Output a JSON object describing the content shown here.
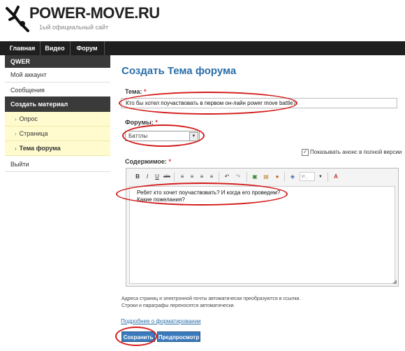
{
  "header": {
    "site_title": "POWER-MOVE.RU",
    "slogan": "1ый официальный сайт"
  },
  "nav": [
    {
      "label": "Главная"
    },
    {
      "label": "Видео"
    },
    {
      "label": "Форум"
    }
  ],
  "sidebar": {
    "username": "QWER",
    "items": [
      {
        "label": "Мой аккаунт"
      },
      {
        "label": "Сообщения"
      },
      {
        "label": "Создать материал"
      },
      {
        "label": "Опрос"
      },
      {
        "label": "Страница"
      },
      {
        "label": "Тема форума"
      },
      {
        "label": "Выйти"
      }
    ]
  },
  "main": {
    "page_title": "Создать Тема форума",
    "title_label": "Тема:",
    "title_value": "Кто бы хотел поучаствовать в первом он-лайн power move battle?",
    "forums_label": "Форумы:",
    "forum_selected": "Баттлы",
    "announce_label": "Показывать анонс в полной версии",
    "announce_checked": true,
    "content_label": "Содержимое:",
    "content_line1": "Ребят кто хочет поучаствовать? И когда его проведем?",
    "content_line2": "Какие пожелания?",
    "help_line1": "Адреса страниц и электронной почты автоматически преобразуются в ссылки.",
    "help_line2": "Строки и параграфы переносятся автоматически.",
    "format_link": "Подробнее о форматировании",
    "save_label": "Сохранить",
    "preview_label": "Предпросмотр",
    "required_mark": "*"
  },
  "toolbar": {
    "bold": "B",
    "italic": "I",
    "underline": "U",
    "strike": "abc",
    "paragraph_placeholder": "P...",
    "font_color": "A"
  },
  "colors": {
    "accent": "#2a6ea8",
    "nav_bg": "#1f1f1f",
    "highlight_ring": "#d41a1a",
    "submenu_bg": "#fffbcf"
  }
}
